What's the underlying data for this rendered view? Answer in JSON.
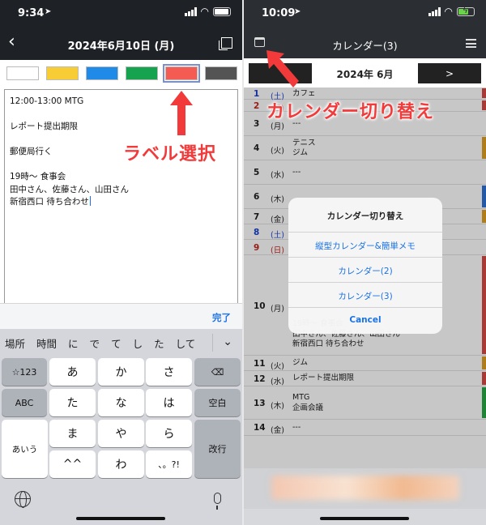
{
  "left": {
    "status": {
      "time": "9:34"
    },
    "header": {
      "title": "2024年6月10日 (月)",
      "back_icon": "chevron-left-icon",
      "copy_icon": "copy-icon"
    },
    "labels": [
      {
        "color": "#ffffff"
      },
      {
        "color": "#f8cc35"
      },
      {
        "color": "#1f8ae8"
      },
      {
        "color": "#16a34f"
      },
      {
        "color": "#f45b52",
        "selected": true
      },
      {
        "color": "#545454"
      }
    ],
    "memo_lines": [
      "12:00-13:00 MTG",
      "",
      "レポート提出期限",
      "",
      "郵便局行く",
      "",
      "19時～ 食事会",
      "田中さん、佐藤さん、山田さん",
      "新宿西口 待ち合わせ"
    ],
    "annotation": "ラベル選択",
    "toolbar": {
      "done": "完了"
    },
    "suggestions": [
      "場所",
      "時間",
      "に",
      "で",
      "て",
      "し",
      "た",
      "して"
    ],
    "keyboard": {
      "row1": [
        "☆123",
        "あ",
        "か",
        "さ",
        "⌫"
      ],
      "row2": [
        "ABC",
        "た",
        "な",
        "は",
        "空白"
      ],
      "row3": [
        "あいう",
        "ま",
        "や",
        "ら",
        "改行"
      ],
      "row4": [
        "^^",
        "わ",
        "、。?!"
      ]
    }
  },
  "right": {
    "status": {
      "time": "10:09"
    },
    "header": {
      "title": "カレンダー(3)",
      "calendar_icon": "calendar-icon",
      "menu_icon": "hamburger-menu-icon"
    },
    "month": {
      "label": "2024年 6月",
      "next": ">"
    },
    "annotation": "カレンダー切り替え",
    "rows": [
      {
        "day": "1",
        "wd": "(土)",
        "text": "カフェ",
        "dayColor": "#1b3fd1",
        "bar": "#d94a45"
      },
      {
        "day": "2",
        "wd": "(日)",
        "text": "",
        "dayColor": "#c2281f",
        "bar": "#d94a45"
      },
      {
        "day": "3",
        "wd": "(月)",
        "text": "---",
        "dayColor": "#222222",
        "bar": ""
      },
      {
        "day": "4",
        "wd": "(火)",
        "text": "テニス\nジム",
        "dayColor": "#222222",
        "bar": "#e0a020"
      },
      {
        "day": "5",
        "wd": "(水)",
        "text": "---",
        "dayColor": "#222222",
        "bar": ""
      },
      {
        "day": "6",
        "wd": "(木)",
        "text": "",
        "dayColor": "#222222",
        "bar": "#2f72d6"
      },
      {
        "day": "7",
        "wd": "(金)",
        "text": "",
        "dayColor": "#222222",
        "bar": "#e0a020"
      },
      {
        "day": "8",
        "wd": "(土)",
        "text": "",
        "dayColor": "#1b3fd1",
        "bar": ""
      },
      {
        "day": "9",
        "wd": "(日)",
        "text": "",
        "dayColor": "#c2281f",
        "bar": ""
      },
      {
        "day": "10",
        "wd": "(月)",
        "text": "\n\n\n\n\n\n19時～ 食事会\n田中さん、佐藤さん、山田さん\n新宿西口 待ち合わせ",
        "dayColor": "#222222",
        "bar": "#d94a45"
      },
      {
        "day": "11",
        "wd": "(火)",
        "text": "ジム",
        "dayColor": "#222222",
        "bar": "#e0a020"
      },
      {
        "day": "12",
        "wd": "(水)",
        "text": "レポート提出期限",
        "dayColor": "#222222",
        "bar": "#d94a45"
      },
      {
        "day": "13",
        "wd": "(木)",
        "text": "MTG\n企画会議",
        "dayColor": "#222222",
        "bar": "#27a844"
      },
      {
        "day": "14",
        "wd": "(金)",
        "text": "---",
        "dayColor": "#222222",
        "bar": ""
      }
    ],
    "dialog": {
      "title": "カレンダー切り替え",
      "options": [
        "縦型カレンダー&簡単メモ",
        "カレンダー(2)",
        "カレンダー(3)"
      ],
      "cancel": "Cancel"
    }
  }
}
